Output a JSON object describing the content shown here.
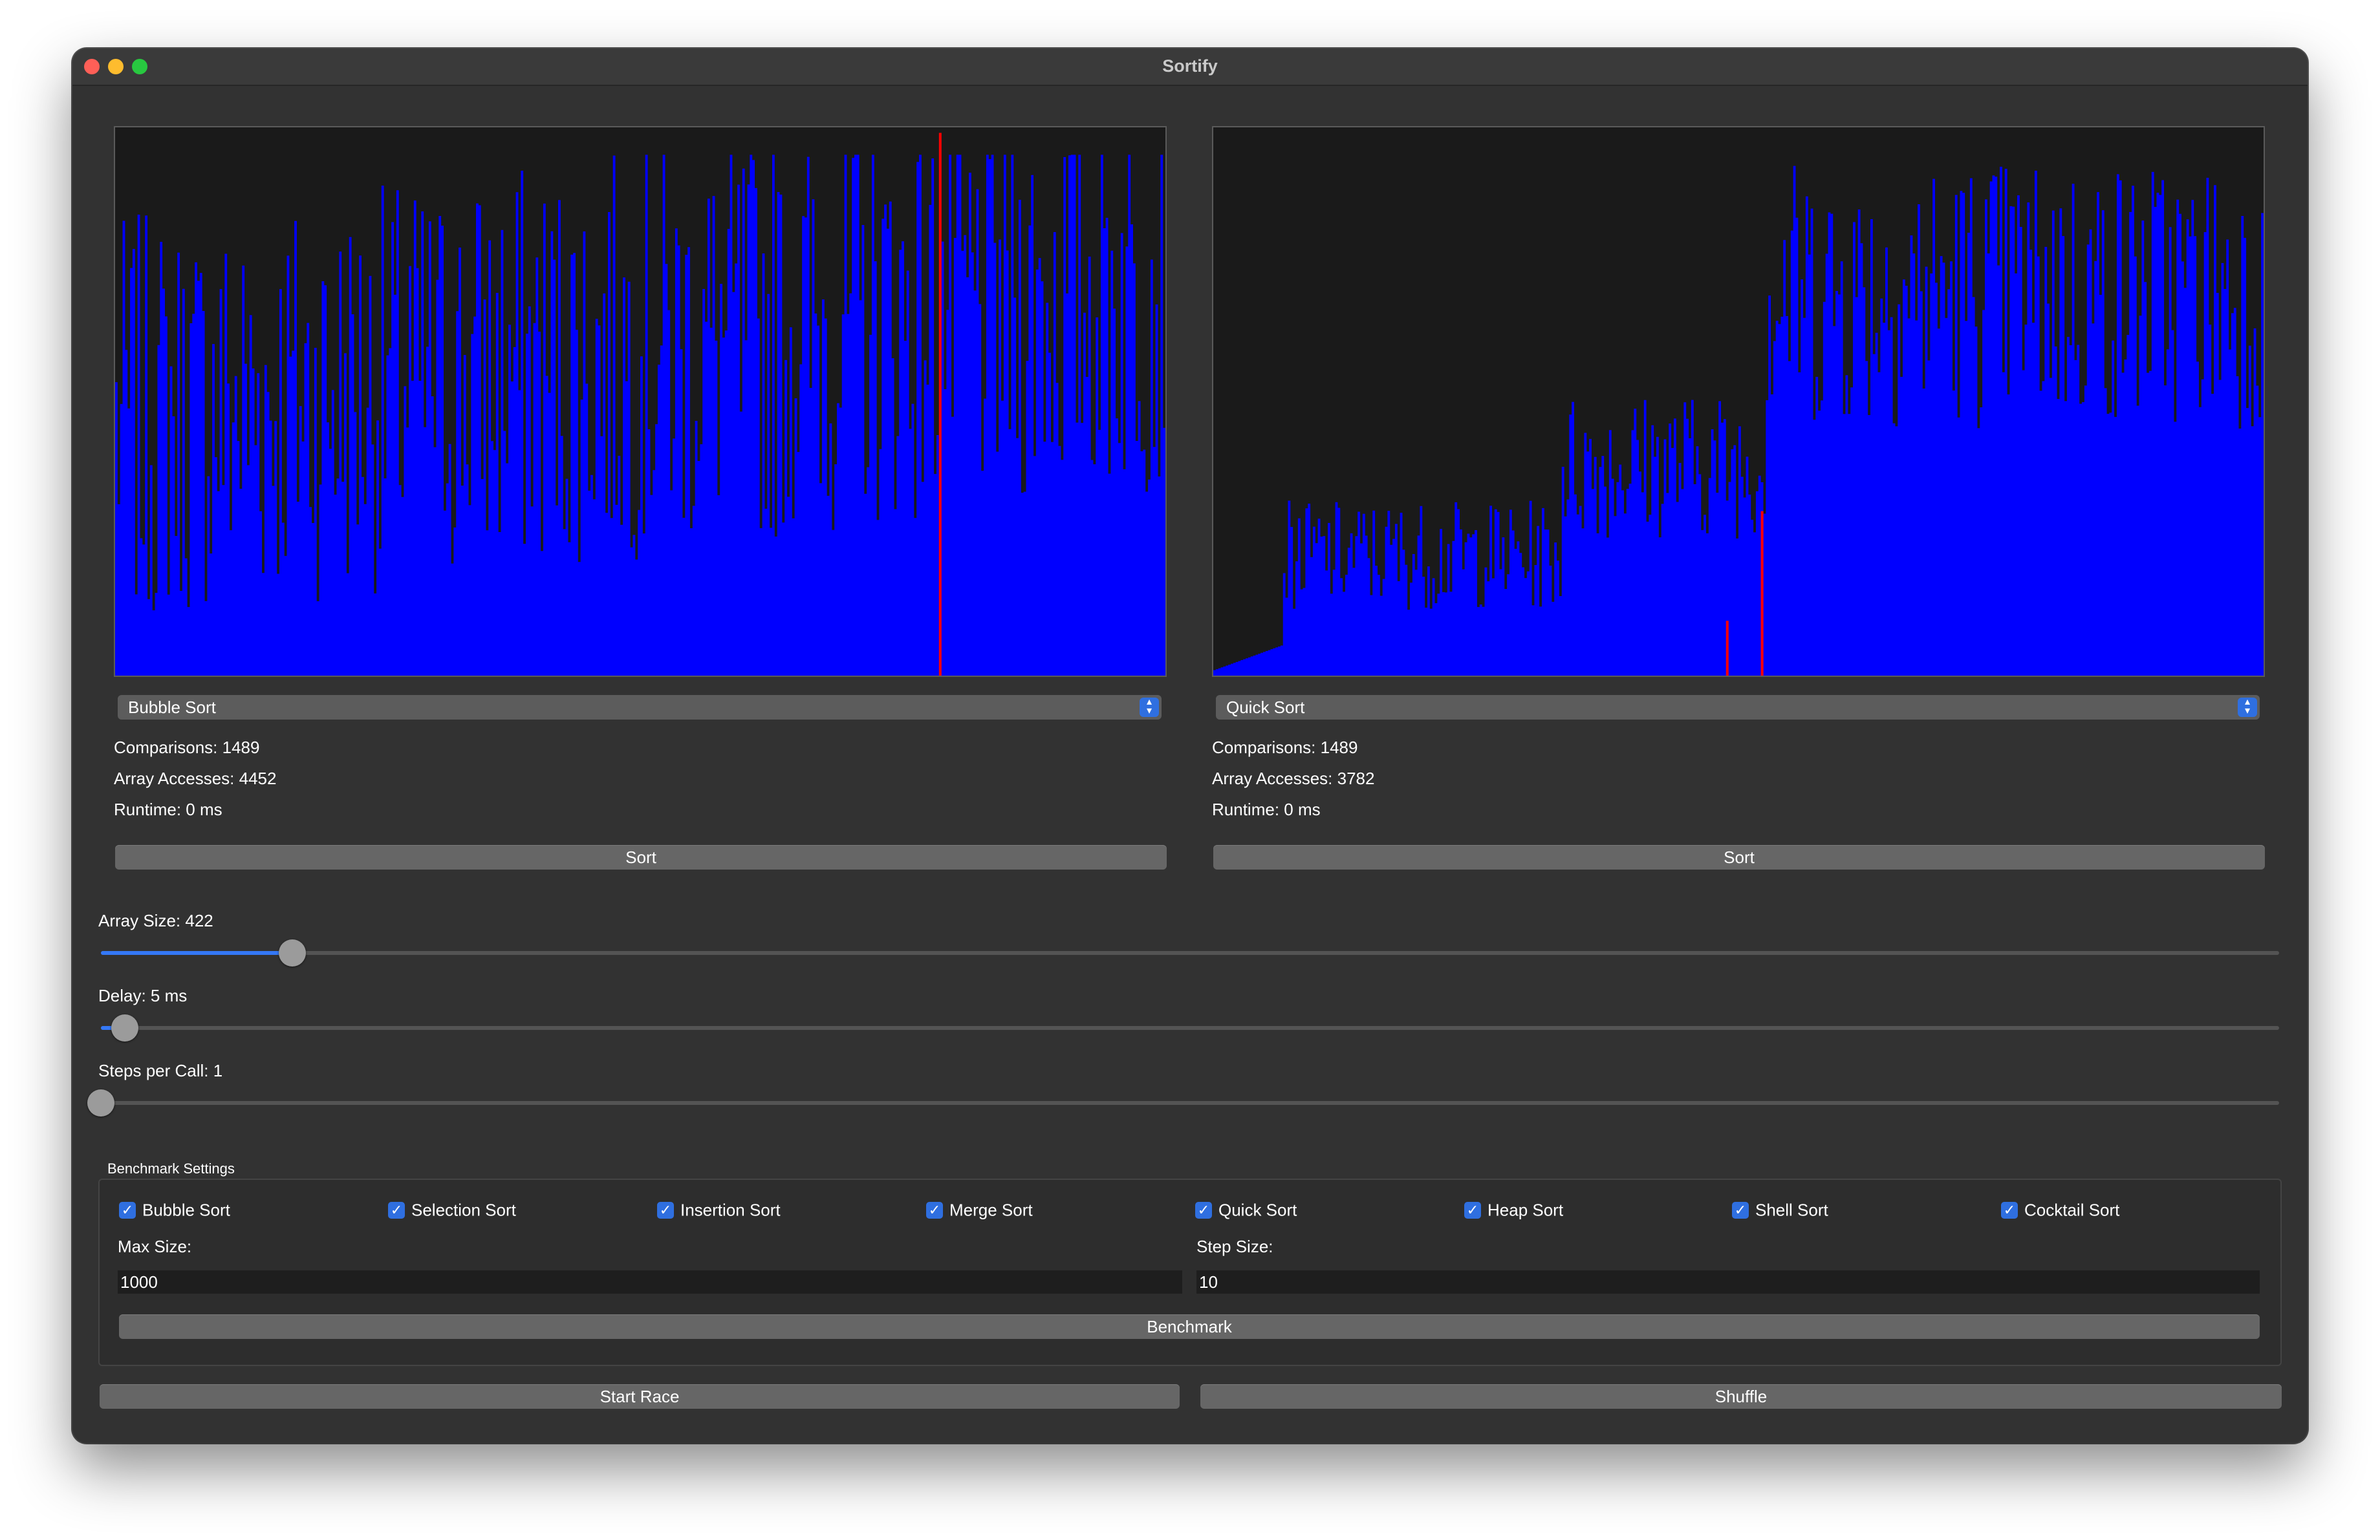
{
  "window": {
    "title": "Sortify"
  },
  "bar_color": "#0000ff",
  "highlight_color": "#ff0000",
  "left_panel": {
    "algorithm": "Bubble Sort",
    "comparisons": "Comparisons: 1489",
    "array_accesses": "Array Accesses: 4452",
    "runtime": "Runtime: 0 ms",
    "sort_label": "Sort"
  },
  "right_panel": {
    "algorithm": "Quick Sort",
    "comparisons": "Comparisons: 1489",
    "array_accesses": "Array Accesses: 3782",
    "runtime": "Runtime: 0 ms",
    "sort_label": "Sort"
  },
  "sliders": {
    "array_size": {
      "label": "Array Size: 422",
      "value": 422,
      "fraction": 0.088
    },
    "delay": {
      "label": "Delay: 5 ms",
      "value": 5,
      "fraction": 0.011
    },
    "steps_per_call": {
      "label": "Steps per Call: 1",
      "value": 1,
      "fraction": 0.0
    }
  },
  "benchmark": {
    "title": "Benchmark Settings",
    "algorithms": [
      {
        "label": "Bubble Sort",
        "checked": true
      },
      {
        "label": "Selection Sort",
        "checked": true
      },
      {
        "label": "Insertion Sort",
        "checked": true
      },
      {
        "label": "Merge Sort",
        "checked": true
      },
      {
        "label": "Quick Sort",
        "checked": true
      },
      {
        "label": "Heap Sort",
        "checked": true
      },
      {
        "label": "Shell Sort",
        "checked": true
      },
      {
        "label": "Cocktail Sort",
        "checked": true
      }
    ],
    "max_size_label": "Max Size:",
    "max_size_value": "1000",
    "step_size_label": "Step Size:",
    "step_size_value": "10",
    "benchmark_label": "Benchmark"
  },
  "footer": {
    "start_race_label": "Start Race",
    "shuffle_label": "Shuffle"
  }
}
